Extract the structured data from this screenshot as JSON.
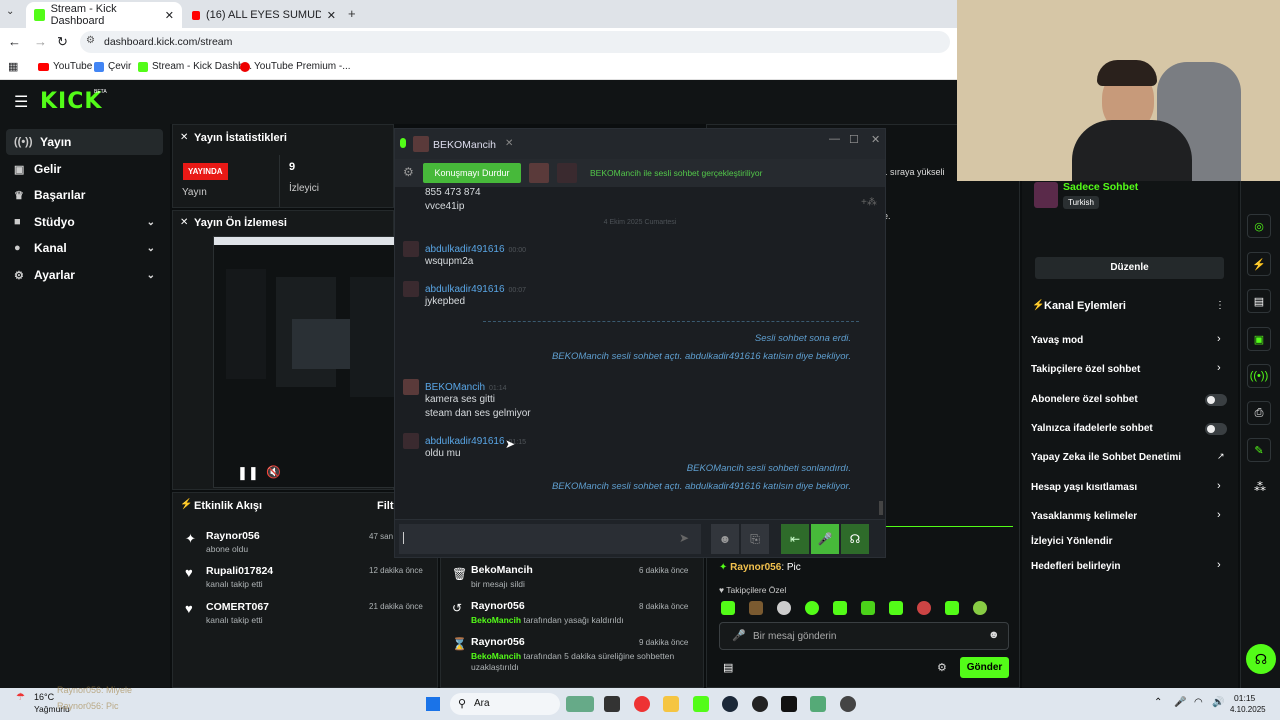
{
  "browser": {
    "tabs": [
      {
        "title": "Stream - Kick Dashboard"
      },
      {
        "title": "(16) ALL EYES SUMUD FLOTILL..."
      }
    ],
    "url": "dashboard.kick.com/stream",
    "bookmarks": [
      "YouTube",
      "Çevir",
      "Stream - Kick Dashb...",
      "YouTube Premium -..."
    ]
  },
  "kick": {
    "logo": "KICK",
    "logo_badge": "BETA",
    "nav": [
      {
        "label": "Yayın",
        "icon": "broadcast-icon"
      },
      {
        "label": "Gelir",
        "icon": "wallet-icon"
      },
      {
        "label": "Başarılar",
        "icon": "trophy-icon"
      },
      {
        "label": "Stüdyo",
        "icon": "camera-icon"
      },
      {
        "label": "Kanal",
        "icon": "user-icon"
      },
      {
        "label": "Ayarlar",
        "icon": "gear-icon"
      }
    ],
    "stats": {
      "title": "Yayın İstatistikleri",
      "live_badge": "YAYINDA",
      "live_label": "Yayın",
      "viewers": "9",
      "viewers_label": "İzleyici"
    },
    "preview": {
      "title": "Yayın Ön İzlemesi"
    },
    "activity": {
      "title": "Etkinlik Akışı",
      "filter": "Filtr",
      "events": [
        {
          "name": "Raynor056",
          "sub": "abone oldu",
          "time": "47 san"
        },
        {
          "name": "Rupali017824",
          "sub": "kanalı takip etti",
          "time": "12 dakika önce"
        },
        {
          "name": "COMERT067",
          "sub": "kanalı takip etti",
          "time": "21 dakika önce"
        }
      ]
    },
    "modlog": [
      {
        "name": "BekoMancih",
        "sub_pre": "",
        "sub": "bir mesajı sildi",
        "time": "6 dakika önce"
      },
      {
        "name": "Raynor056",
        "sub_pre": "BekoMancih",
        "sub": "tarafından yasağı kaldırıldı",
        "time": "8 dakika önce"
      },
      {
        "name": "Raynor056",
        "sub_pre": "BekoMancih",
        "sub": "tarafından 5 dakika süreliğine sohbetten uzaklaştırıldı",
        "time": "9 dakika önce"
      }
    ],
    "banner_partial": "k 1. sıraya yükseli",
    "notice_partial": "age.",
    "chat": {
      "last_user": "Raynor056",
      "last_msg": "Pic",
      "followers_only": "Takipçilere Özel",
      "placeholder": "Bir mesaj gönderin",
      "send": "Gönder"
    },
    "chat_mode": {
      "title": "Sadece Sohbet",
      "lang": "Turkish",
      "edit": "Düzenle"
    },
    "channel_actions": {
      "title": "Kanal Eylemleri",
      "items": [
        {
          "label": "Yavaş mod",
          "kind": "chevron"
        },
        {
          "label": "Takipçilere özel sohbet",
          "kind": "chevron"
        },
        {
          "label": "Abonelere özel sohbet",
          "kind": "toggle"
        },
        {
          "label": "Yalnızca ifadelerle sohbet",
          "kind": "toggle"
        },
        {
          "label": "Yapay Zeka ile Sohbet Denetimi",
          "kind": "external"
        },
        {
          "label": "Hesap yaşı kısıtlaması",
          "kind": "chevron"
        },
        {
          "label": "Yasaklanmış kelimeler",
          "kind": "chevron"
        },
        {
          "label": "İzleyici Yönlendir",
          "kind": "none"
        },
        {
          "label": "Hedefleri belirleyin",
          "kind": "chevron"
        }
      ]
    }
  },
  "steam": {
    "title": "BEKOMancih",
    "stop_button": "Konuşmayı Durdur",
    "voice_status": "BEKOMancih ile sesli sohbet gerçekleştiriliyor",
    "top_lines": [
      "855 473 874",
      "vvce41ip"
    ],
    "date_divider": "4 Ekim 2025 Cumartesi",
    "messages": [
      {
        "user": "abdulkadir491616",
        "time": "00:00",
        "text": "wsqupm2a"
      },
      {
        "user": "abdulkadir491616",
        "time": "00:07",
        "text": "jykepbed"
      }
    ],
    "system1": [
      "Sesli sohbet sona erdi.",
      "BEKOMancih sesli sohbet açtı. abdulkadir491616 katılsın diye bekliyor."
    ],
    "beko_msg": {
      "user": "BEKOMancih",
      "time": "01:14",
      "lines": [
        "kamera ses gitti",
        "steam dan ses gelmiyor"
      ]
    },
    "last_msg": {
      "user": "abdulkadir491616",
      "time": "01:15",
      "text": "oldu mu"
    },
    "system2": [
      "BEKOMancih sesli sohbeti sonlandırdı.",
      "BEKOMancih sesli sohbet açtı. abdulkadir491616 katılsın diye bekliyor."
    ]
  },
  "taskbar": {
    "weather_temp": "16°C",
    "weather_desc": "Yağmurlu",
    "search": "Ara",
    "time": "01:15",
    "date": "4.10.2025"
  },
  "overlay": {
    "ticker1": "Raynor056: Miyele",
    "ticker2": "Raynor056: Pic"
  },
  "colors": {
    "kick_green": "#53fc18",
    "panel": "#16191a",
    "steam_bg": "#1b1e22",
    "steam_link": "#59a6e6",
    "live_red": "#e91916"
  }
}
